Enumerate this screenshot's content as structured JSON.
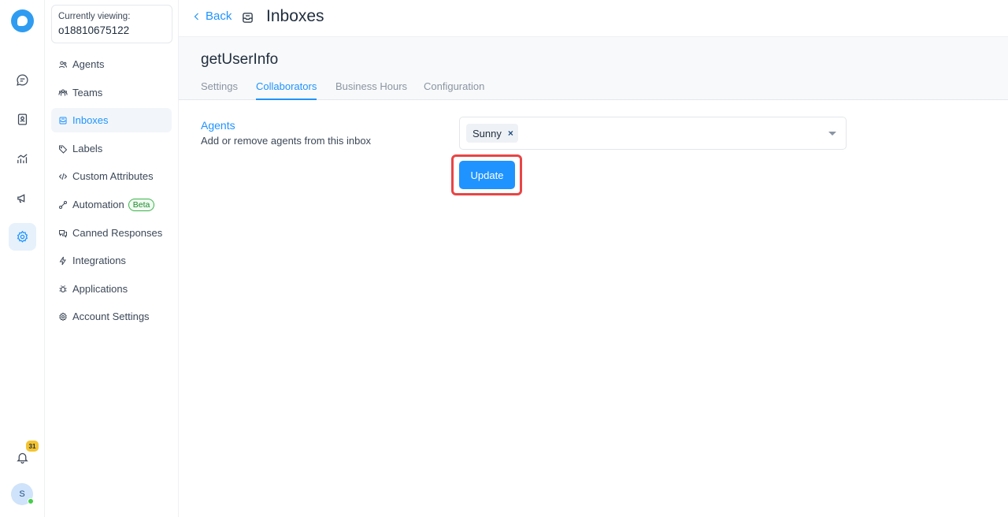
{
  "rail": {
    "items": [
      {
        "name": "conversations",
        "icon": "chat-bubble-icon"
      },
      {
        "name": "contacts",
        "icon": "contact-book-icon"
      },
      {
        "name": "reports",
        "icon": "chart-trend-icon"
      },
      {
        "name": "campaigns",
        "icon": "megaphone-icon"
      },
      {
        "name": "settings",
        "icon": "gear-icon",
        "active": true
      }
    ],
    "notifications_count": "31",
    "avatar_initial": "S",
    "accent": "#1f93ff"
  },
  "sidebar": {
    "viewing_label": "Currently viewing:",
    "viewing_value": "o18810675122",
    "items": [
      {
        "label": "Agents",
        "icon": "users-icon"
      },
      {
        "label": "Teams",
        "icon": "team-icon"
      },
      {
        "label": "Inboxes",
        "icon": "inbox-icon",
        "active": true
      },
      {
        "label": "Labels",
        "icon": "tag-icon"
      },
      {
        "label": "Custom Attributes",
        "icon": "code-icon"
      },
      {
        "label": "Automation",
        "icon": "automation-icon",
        "badge": "Beta"
      },
      {
        "label": "Canned Responses",
        "icon": "chat-multiple-icon"
      },
      {
        "label": "Integrations",
        "icon": "flash-icon"
      },
      {
        "label": "Applications",
        "icon": "bug-icon"
      },
      {
        "label": "Account Settings",
        "icon": "gear-icon"
      }
    ]
  },
  "topbar": {
    "back_label": "Back",
    "title": "Inboxes"
  },
  "inbox": {
    "name": "getUserInfo",
    "tabs": [
      {
        "label": "Settings"
      },
      {
        "label": "Collaborators",
        "active": true
      },
      {
        "label": "Business Hours"
      },
      {
        "label": "Configuration"
      }
    ]
  },
  "collaborators": {
    "field_title": "Agents",
    "field_description": "Add or remove agents from this inbox",
    "selected_agents": [
      "Sunny"
    ],
    "remove_glyph": "×",
    "update_label": "Update"
  }
}
